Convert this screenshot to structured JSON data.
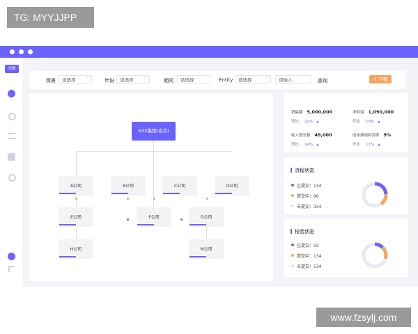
{
  "watermarks": {
    "top_left": "TG: MYYJJPP",
    "bottom_right": "www.fzsylj.com"
  },
  "colors": {
    "accent": "#6c63ff",
    "orange": "#f7a35c"
  },
  "sidebar": {
    "logo_text": "光舸",
    "icons": [
      "pie-chart-icon",
      "gear-icon",
      "list-icon",
      "database-icon",
      "clock-icon",
      "user-icon",
      "document-icon"
    ]
  },
  "filters": {
    "scene_label": "情景",
    "scene_placeholder": "请选择",
    "year_label": "年份",
    "year_placeholder": "请选择",
    "period_label": "期间",
    "period_placeholder": "请选择",
    "entity_label": "Entity",
    "entity_placeholder": "请选择",
    "input_placeholder": "请输入",
    "query_label": "查询",
    "download_label": "下载"
  },
  "org": {
    "group": "XXX集团(合并)",
    "companies": [
      {
        "name": "A公司",
        "progress": 0.5
      },
      {
        "name": "B公司",
        "progress": 0.5
      },
      {
        "name": "C公司",
        "progress": 0.5
      },
      {
        "name": "D公司",
        "progress": 0.5
      },
      {
        "name": "E公司",
        "progress": 0.5
      },
      {
        "name": "F公司",
        "progress": 0.5
      },
      {
        "name": "G公司",
        "progress": 0.5
      },
      {
        "name": "H公司",
        "progress": 0.5
      },
      {
        "name": "M公司",
        "progress": 0.5
      }
    ]
  },
  "kpis": [
    {
      "label": "销售额",
      "value": "5,000,000",
      "sub_label": "环比",
      "sub_value": "22%"
    },
    {
      "label": "净利润",
      "value": "1,090,000",
      "sub_label": "环比",
      "sub_value": "19%"
    },
    {
      "label": "收入增长额",
      "value": "49,000",
      "sub_label": "环比",
      "sub_value": "14%"
    },
    {
      "label": "成本费用利润率",
      "value": "9%",
      "sub_label": "环比",
      "sub_value": "11%"
    }
  ],
  "flow_status": {
    "title": "流程状态",
    "items": [
      {
        "label": "已提交：134",
        "color": "#6c63ff"
      },
      {
        "label": "提交中：90",
        "color": "#f7a35c"
      },
      {
        "label": "未提交：334",
        "color": "#e3e5ee"
      }
    ],
    "donut": {
      "submitted": 134,
      "submitting": 90,
      "not_submitted": 334
    }
  },
  "check_status": {
    "title": "校验状态",
    "items": [
      {
        "label": "已提交：93",
        "color": "#6c63ff"
      },
      {
        "label": "提交中：134",
        "color": "#f7a35c"
      },
      {
        "label": "未提交：534",
        "color": "#e3e5ee"
      }
    ],
    "donut": {
      "submitted": 93,
      "submitting": 134,
      "not_submitted": 534
    }
  }
}
